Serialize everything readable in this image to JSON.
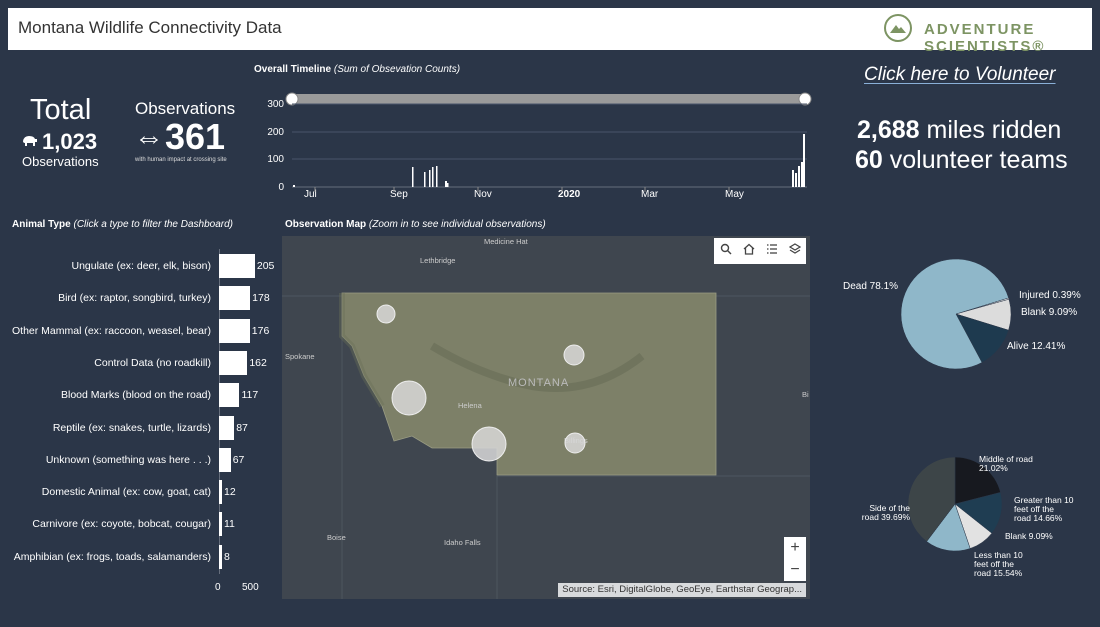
{
  "header": {
    "title": "Montana Wildlife Connectivity Data",
    "logo_text": "ADVENTURE SCIENTISTS®"
  },
  "totals": {
    "total_label": "Total",
    "total_value": "1,023",
    "total_sub": "Observations",
    "obs_label": "Observations",
    "obs_value": "361",
    "obs_sub": "with human impact at crossing site"
  },
  "timeline": {
    "title_bold": "Overall Timeline",
    "title_italic": "(Sum of Obsevation Counts)"
  },
  "volunteer": {
    "link": "Click here to Volunteer",
    "miles_value": "2,688",
    "miles_label": " miles ridden",
    "teams_value": "60",
    "teams_label": " volunteer teams"
  },
  "animal": {
    "title_bold": "Animal Type",
    "title_italic": "(Click a type to filter the Dashboard)",
    "axis_min": "0",
    "axis_max": "500",
    "items": [
      {
        "name": "Ungulate (ex: deer, elk, bison)",
        "count": 205
      },
      {
        "name": "Bird (ex: raptor, songbird, turkey)",
        "count": 178
      },
      {
        "name": "Other Mammal (ex: raccoon, weasel, bear)",
        "count": 176
      },
      {
        "name": "Control Data (no roadkill)",
        "count": 162
      },
      {
        "name": "Blood Marks (blood on the road)",
        "count": 117
      },
      {
        "name": "Reptile (ex: snakes, turtle, lizards)",
        "count": 87
      },
      {
        "name": "Unknown (something was here . . .)",
        "count": 67
      },
      {
        "name": "Domestic Animal (ex: cow, goat, cat)",
        "count": 12
      },
      {
        "name": "Carnivore (ex: coyote, bobcat, cougar)",
        "count": 11
      },
      {
        "name": "Amphibian (ex: frogs, toads, salamanders)",
        "count": 8
      }
    ]
  },
  "map": {
    "title_bold": "Observation Map",
    "title_italic": "(Zoom in to see individual observations)",
    "attribution": "Source: Esri, DigitalGlobe, GeoEye, Earthstar Geograp...",
    "state_label": "MONTANA",
    "labels": [
      "Medicine Hat",
      "Lethbridge",
      "Spokane",
      "Helena",
      "Billings",
      "Boise",
      "Idaho Falls",
      "Bi"
    ],
    "zoom_in": "+",
    "zoom_out": "−"
  },
  "chart_data": [
    {
      "type": "bar",
      "title": "Overall Timeline (Sum of Obsevation Counts)",
      "x_ticks": [
        "Jul",
        "Sep",
        "Nov",
        "2020",
        "Mar",
        "May"
      ],
      "y_ticks": [
        0,
        100,
        200,
        300
      ],
      "ylim": [
        0,
        300
      ],
      "grid": true
    },
    {
      "type": "bar",
      "title": "Animal Type",
      "categories": [
        "Ungulate (ex: deer, elk, bison)",
        "Bird (ex: raptor, songbird, turkey)",
        "Other Mammal (ex: raccoon, weasel, bear)",
        "Control Data (no roadkill)",
        "Blood Marks (blood on the road)",
        "Reptile (ex: snakes, turtle, lizards)",
        "Unknown (something was here . . .)",
        "Domestic Animal (ex: cow, goat, cat)",
        "Carnivore (ex: coyote, bobcat, cougar)",
        "Amphibian (ex: frogs, toads, salamanders)"
      ],
      "values": [
        205,
        178,
        176,
        162,
        117,
        87,
        67,
        12,
        11,
        8
      ],
      "xlim": [
        0,
        500
      ]
    },
    {
      "type": "pie",
      "slices": [
        {
          "label": "Dead 78.1%",
          "value": 78.1,
          "color": "#8fb7c9"
        },
        {
          "label": "Alive 12.41%",
          "value": 12.41,
          "color": "#1e3a4f"
        },
        {
          "label": "Blank 9.09%",
          "value": 9.09,
          "color": "#dcdcdc"
        },
        {
          "label": "Injured 0.39%",
          "value": 0.39,
          "color": "#f5f5f5"
        }
      ]
    },
    {
      "type": "pie",
      "slices": [
        {
          "label": "Middle of road 21.02%",
          "value": 21.02,
          "color": "#17191f"
        },
        {
          "label": "Greater than 10 feet off the road 14.66%",
          "value": 14.66,
          "color": "#1f3d52"
        },
        {
          "label": "Blank 9.09%",
          "value": 9.09,
          "color": "#e2e2e2"
        },
        {
          "label": "Less than 10 feet off the road 15.54%",
          "value": 15.54,
          "color": "#8fb7c9"
        },
        {
          "label": "Side of the road 39.69%",
          "value": 39.69,
          "color": "#3d4548"
        }
      ]
    }
  ]
}
